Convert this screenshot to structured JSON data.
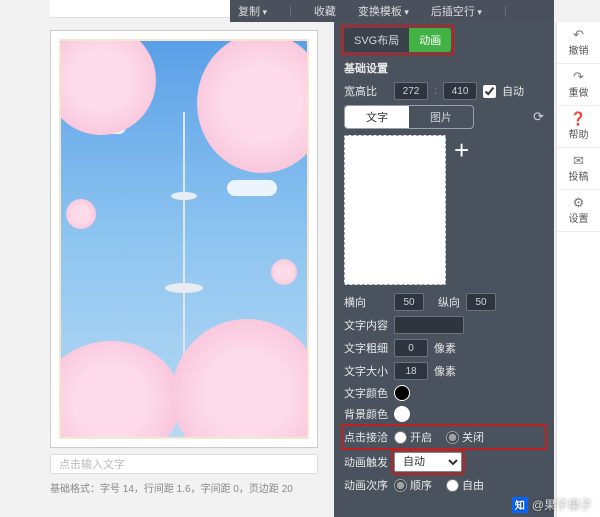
{
  "topbar": {
    "copy": "复制",
    "favorite": "收藏",
    "transform": "变换模板",
    "back_blank": "后插空行"
  },
  "arrow_glyph": "↘",
  "panel_tabs": {
    "svg_layout": "SVG布局",
    "animation": "动画"
  },
  "basic": {
    "title": "基础设置",
    "aspect_label": "宽高比",
    "width": "272",
    "height": "410",
    "sep": ":",
    "auto_label": "自动"
  },
  "media_tabs": {
    "text": "文字",
    "image": "图片"
  },
  "plus": "+",
  "spacing": {
    "h_label": "横向",
    "h_val": "50",
    "v_label": "纵向",
    "v_val": "50"
  },
  "content": {
    "label": "文字内容"
  },
  "weight": {
    "label": "文字粗细",
    "val": "0",
    "unit": "像素"
  },
  "size": {
    "label": "文字大小",
    "val": "18",
    "unit": "像素"
  },
  "color_text": {
    "label": "文字颜色"
  },
  "color_bg": {
    "label": "背景颜色"
  },
  "click_contact": {
    "label": "点击接洽",
    "on": "开启",
    "off": "关闭"
  },
  "trigger": {
    "label": "动画触发",
    "value": "自动"
  },
  "sequence": {
    "label": "动画次序",
    "order": "顺序",
    "free": "自由"
  },
  "rail": {
    "undo": "撤销",
    "redo": "重做",
    "help": "帮助",
    "submit": "投稿",
    "settings": "设置"
  },
  "icons": {
    "undo": "↶",
    "redo": "↷",
    "help": "❓",
    "submit": "✉",
    "settings": "⚙",
    "refresh": "⟳"
  },
  "placeholder": "点击输入文字",
  "baseline": "基础格式：字号 14，行间距 1.6，字间距 0，页边距 20",
  "watermark": "@果子果子"
}
